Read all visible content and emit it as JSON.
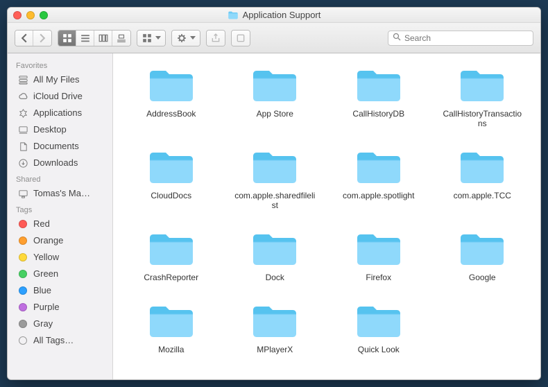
{
  "window": {
    "title": "Application Support"
  },
  "search": {
    "placeholder": "Search"
  },
  "sidebar": {
    "sections": [
      {
        "header": "Favorites",
        "items": [
          {
            "label": "All My Files",
            "icon": "all-files"
          },
          {
            "label": "iCloud Drive",
            "icon": "cloud"
          },
          {
            "label": "Applications",
            "icon": "apps"
          },
          {
            "label": "Desktop",
            "icon": "desktop"
          },
          {
            "label": "Documents",
            "icon": "documents"
          },
          {
            "label": "Downloads",
            "icon": "downloads"
          }
        ]
      },
      {
        "header": "Shared",
        "items": [
          {
            "label": "Tomas's Ma…",
            "icon": "monitor"
          }
        ]
      },
      {
        "header": "Tags",
        "items": [
          {
            "label": "Red",
            "color": "#ff5b56"
          },
          {
            "label": "Orange",
            "color": "#ff9f2f"
          },
          {
            "label": "Yellow",
            "color": "#ffd93a"
          },
          {
            "label": "Green",
            "color": "#47d063"
          },
          {
            "label": "Blue",
            "color": "#2da0ff"
          },
          {
            "label": "Purple",
            "color": "#bf6ee0"
          },
          {
            "label": "Gray",
            "color": "#9b9b9b"
          },
          {
            "label": "All Tags…",
            "outline": true
          }
        ]
      }
    ]
  },
  "folders": [
    {
      "name": "AddressBook"
    },
    {
      "name": "App Store"
    },
    {
      "name": "CallHistoryDB"
    },
    {
      "name": "CallHistoryTransactions"
    },
    {
      "name": "CloudDocs"
    },
    {
      "name": "com.apple.sharedfilelist"
    },
    {
      "name": "com.apple.spotlight"
    },
    {
      "name": "com.apple.TCC"
    },
    {
      "name": "CrashReporter"
    },
    {
      "name": "Dock"
    },
    {
      "name": "Firefox"
    },
    {
      "name": "Google"
    },
    {
      "name": "Mozilla"
    },
    {
      "name": "MPlayerX"
    },
    {
      "name": "Quick Look"
    }
  ]
}
